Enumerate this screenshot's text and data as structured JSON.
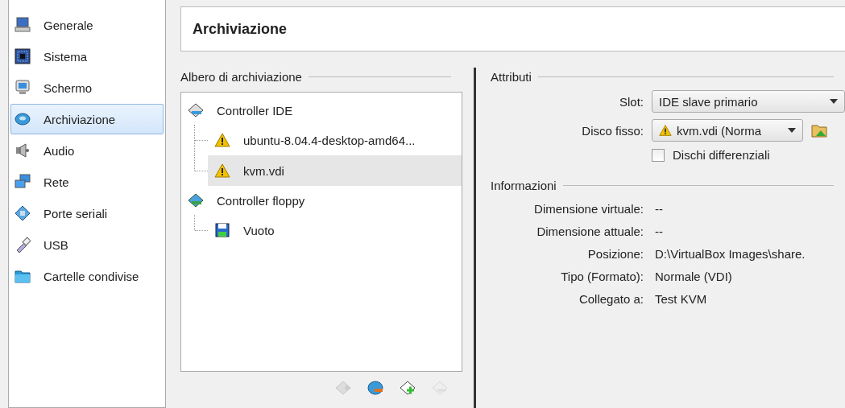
{
  "sidebar": {
    "items": [
      {
        "label": "Generale",
        "kind": "computer",
        "selected": false
      },
      {
        "label": "Sistema",
        "kind": "chip",
        "selected": false
      },
      {
        "label": "Schermo",
        "kind": "monitor",
        "selected": false
      },
      {
        "label": "Archiviazione",
        "kind": "disk",
        "selected": true
      },
      {
        "label": "Audio",
        "kind": "speaker",
        "selected": false
      },
      {
        "label": "Rete",
        "kind": "network",
        "selected": false
      },
      {
        "label": "Porte seriali",
        "kind": "serial",
        "selected": false
      },
      {
        "label": "USB",
        "kind": "usb",
        "selected": false
      },
      {
        "label": "Cartelle condivise",
        "kind": "folder",
        "selected": false
      }
    ]
  },
  "header": {
    "title": "Archiviazione"
  },
  "storage_tree": {
    "title": "Albero di archiviazione",
    "controllers": [
      {
        "label": "Controller IDE",
        "kind": "ide",
        "selected": false,
        "children": [
          {
            "label": "ubuntu-8.04.4-desktop-amd64...",
            "kind": "warning",
            "selected": false
          },
          {
            "label": "kvm.vdi",
            "kind": "warning",
            "selected": true
          }
        ]
      },
      {
        "label": "Controller floppy",
        "kind": "floppy-controller",
        "selected": false,
        "children": [
          {
            "label": "Vuoto",
            "kind": "floppy",
            "selected": false
          }
        ]
      }
    ],
    "toolbar": [
      {
        "kind": "add-controller",
        "disabled": true
      },
      {
        "kind": "remove-controller",
        "disabled": false
      },
      {
        "kind": "add-attachment",
        "disabled": false
      },
      {
        "kind": "remove-attachment",
        "disabled": true
      }
    ]
  },
  "attributes": {
    "title": "Attributi",
    "slot": {
      "label": "Slot:",
      "value": "IDE slave primario"
    },
    "disk": {
      "label": "Disco fisso:",
      "value": "kvm.vdi (Norma"
    },
    "differencing": {
      "label": "Dischi differenziali",
      "checked": false
    }
  },
  "information": {
    "title": "Informazioni",
    "rows": [
      {
        "label": "Dimensione virtuale:",
        "value": "--"
      },
      {
        "label": "Dimensione attuale:",
        "value": "--"
      },
      {
        "label": "Posizione:",
        "value": "D:\\VirtualBox Images\\share."
      },
      {
        "label": "Tipo (Formato):",
        "value": "Normale (VDI)"
      },
      {
        "label": "Collegato a:",
        "value": "Test KVM"
      }
    ]
  }
}
